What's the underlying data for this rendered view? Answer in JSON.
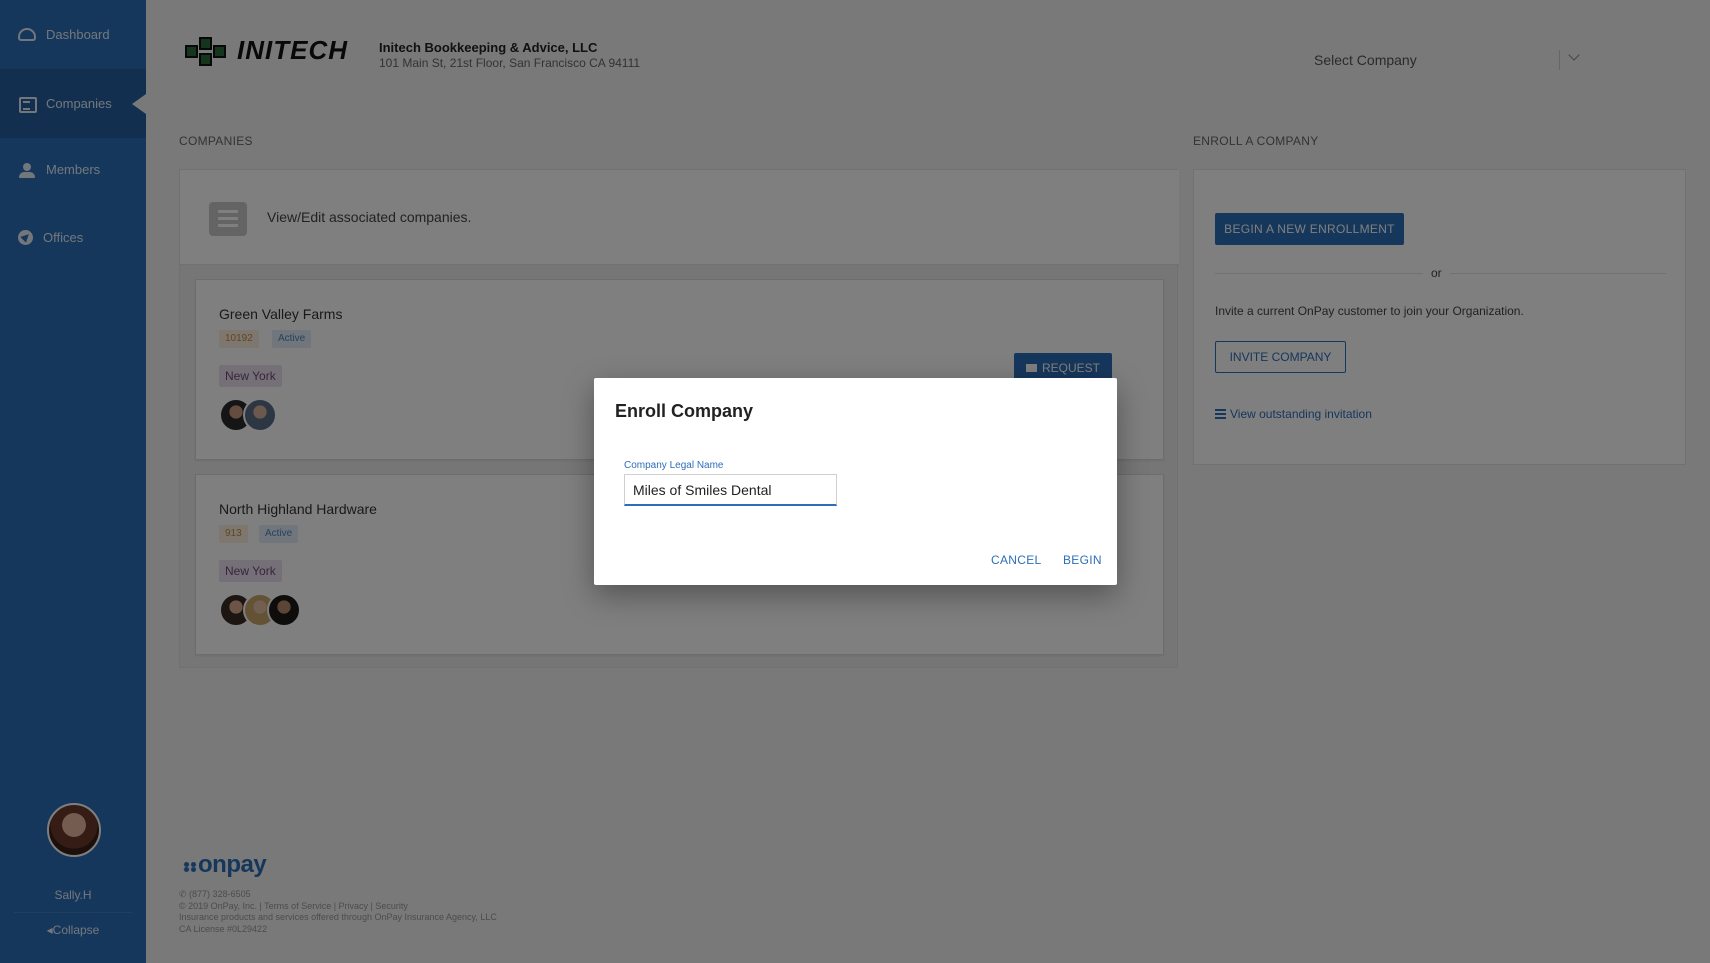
{
  "sidebar": {
    "items": [
      {
        "label": "Dashboard",
        "icon": "dashboard-icon"
      },
      {
        "label": "Companies",
        "icon": "list-icon",
        "active": true
      },
      {
        "label": "Members",
        "icon": "users-icon"
      },
      {
        "label": "Offices",
        "icon": "location-arrow-icon"
      }
    ],
    "user_name": "Sally.H",
    "collapse_label": "Collapse"
  },
  "header": {
    "logo_text": "INITECH",
    "firm_name": "Initech Bookkeeping & Advice, LLC",
    "firm_address": "101 Main St, 21st Floor, San Francisco CA 94111",
    "company_select_placeholder": "Select Company"
  },
  "companies": {
    "section_title": "COMPANIES",
    "info_text": "View/Edit associated companies.",
    "request_label": "REQUEST",
    "list": [
      {
        "name": "Green Valley Farms",
        "id": "10192",
        "status": "Active",
        "office": "New York"
      },
      {
        "name": "North Highland Hardware",
        "id": "913",
        "status": "Active",
        "office": "New York"
      }
    ]
  },
  "enroll": {
    "section_title": "ENROLL A COMPANY",
    "begin_label": "BEGIN A NEW ENROLLMENT",
    "or_label": "or",
    "invite_text": "Invite a current OnPay customer to join your Organization.",
    "invite_label": "INVITE COMPANY",
    "outstanding_link": "View outstanding invitation"
  },
  "footer": {
    "logo": "onpay",
    "phone": "(877) 328-6505",
    "legal": "© 2019 OnPay, Inc. | Terms of Service | Privacy | Security",
    "insurance": "Insurance products and services offered through OnPay Insurance Agency, LLC",
    "license": "CA License #0L29422"
  },
  "modal": {
    "title": "Enroll Company",
    "field_label": "Company Legal Name",
    "field_value": "Miles of Smiles Dental",
    "cancel_label": "CANCEL",
    "begin_label": "BEGIN"
  },
  "colors": {
    "primary": "#2c6fb8",
    "overlay": "rgba(0,0,0,0.5)"
  }
}
